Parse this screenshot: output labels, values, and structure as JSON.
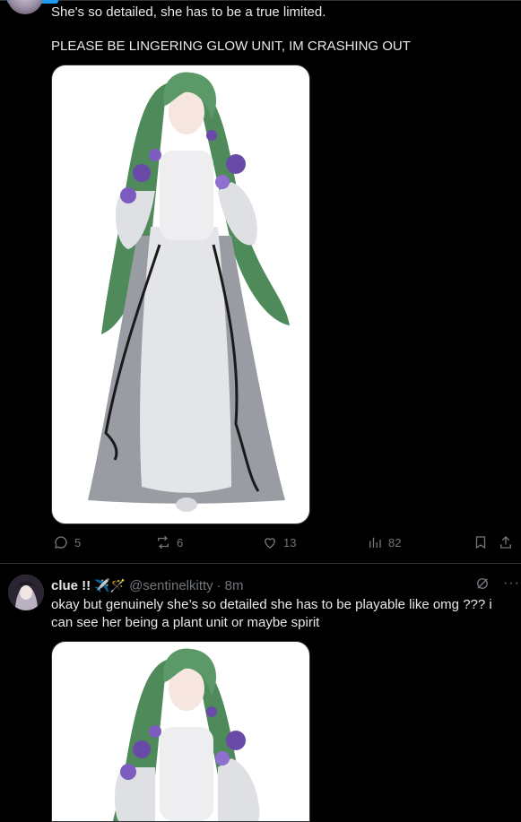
{
  "tweet1": {
    "line1": "She's so detailed, she has to be a true limited.",
    "line2": "PLEASE BE LINGERING GLOW UNIT, IM CRASHING OUT",
    "stats": {
      "replies": "5",
      "retweets": "6",
      "likes": "13",
      "views": "82"
    }
  },
  "tweet2": {
    "name": "clue !!",
    "emoji": "✈️🪄",
    "handle": "@sentinelkitty",
    "sep": "·",
    "time": "8m",
    "more": "···",
    "text": "okay but genuinely she’s so detailed she has to be playable like omg ??? i can see her being a plant unit or maybe spirit"
  },
  "colors": {
    "accent": "#1d9bf0",
    "muted": "#71767b",
    "text": "#e7e9ea",
    "border": "#2f3336"
  }
}
